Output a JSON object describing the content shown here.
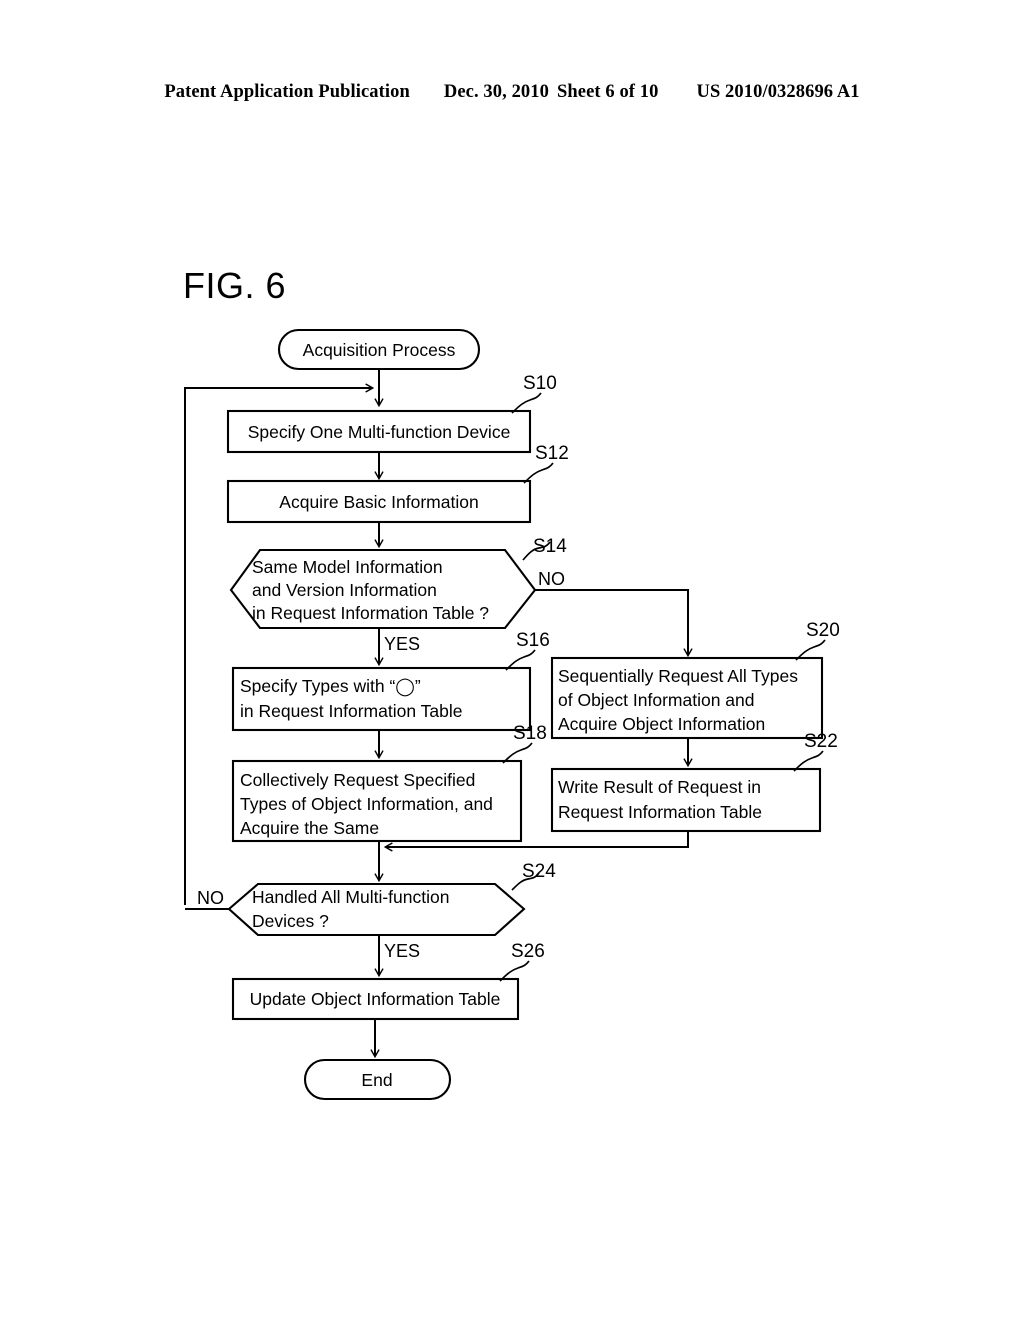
{
  "header": {
    "publication": "Patent Application Publication",
    "date": "Dec. 30, 2010",
    "sheet": "Sheet 6 of 10",
    "doc_number": "US 2010/0328696 A1"
  },
  "figure": {
    "title": "FIG. 6"
  },
  "flowchart": {
    "type": "flowchart",
    "start": {
      "label": "Acquisition Process"
    },
    "end": {
      "label": "End"
    },
    "nodes": [
      {
        "id": "S10",
        "step": "S10",
        "shape": "process",
        "lines": [
          "Specify One Multi-function Device"
        ]
      },
      {
        "id": "S12",
        "step": "S12",
        "shape": "process",
        "lines": [
          "Acquire Basic Information"
        ]
      },
      {
        "id": "S14",
        "step": "S14",
        "shape": "decision",
        "lines": [
          "Same Model Information",
          "and Version Information",
          "in Request Information Table ?"
        ]
      },
      {
        "id": "S16",
        "step": "S16",
        "shape": "process",
        "lines": [
          "Specify Types with “◯”",
          "in Request Information Table"
        ]
      },
      {
        "id": "S18",
        "step": "S18",
        "shape": "process",
        "lines": [
          "Collectively Request Specified",
          "Types of Object Information, and",
          "Acquire the Same"
        ]
      },
      {
        "id": "S20",
        "step": "S20",
        "shape": "process",
        "lines": [
          "Sequentially Request All Types",
          "of Object Information and",
          "Acquire Object Information"
        ]
      },
      {
        "id": "S22",
        "step": "S22",
        "shape": "process",
        "lines": [
          "Write Result of Request in",
          "Request Information Table"
        ]
      },
      {
        "id": "S24",
        "step": "S24",
        "shape": "decision",
        "lines": [
          "Handled All Multi-function",
          "Devices ?"
        ]
      },
      {
        "id": "S26",
        "step": "S26",
        "shape": "process",
        "lines": [
          "Update Object Information Table"
        ]
      }
    ],
    "branch_labels": {
      "s14_no": "NO",
      "s14_yes": "YES",
      "s24_no": "NO",
      "s24_yes": "YES"
    },
    "colors": {
      "stroke": "#000000",
      "background": "#ffffff"
    }
  }
}
